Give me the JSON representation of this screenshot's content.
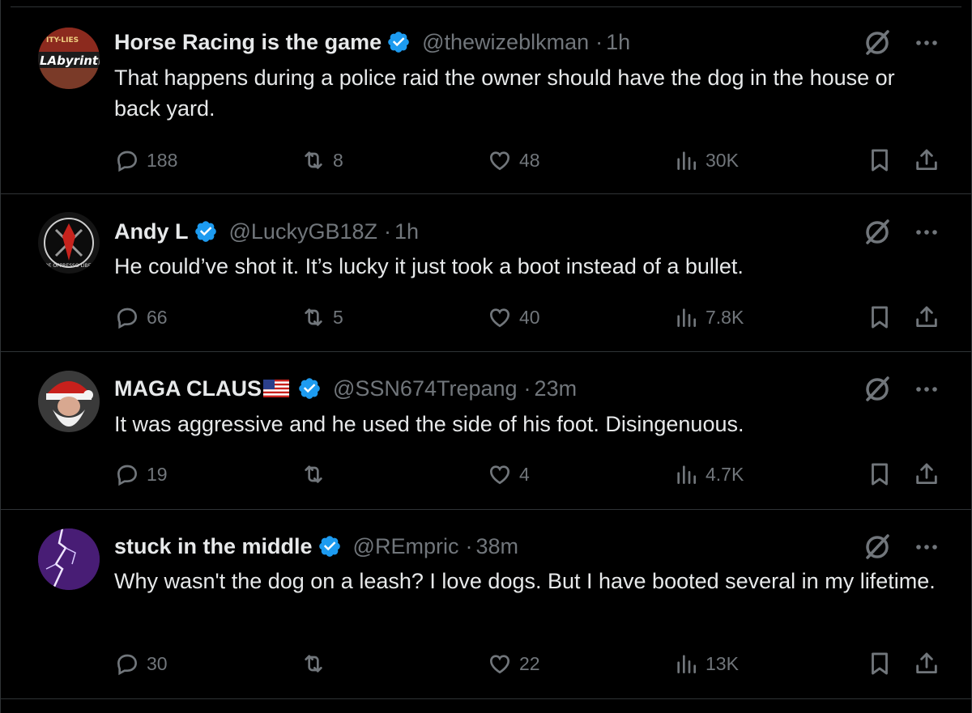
{
  "colors": {
    "background": "#000000",
    "text": "#e7e9ea",
    "muted": "#71767b",
    "divider": "#2f3336",
    "verified": "#1d9bf0"
  },
  "tweets": [
    {
      "name": "Horse Racing is the game",
      "handle": "@thewizeblkman",
      "sep": "·",
      "time": "1h",
      "text": "That happens during a police raid the owner should have the dog in the house or back yard.",
      "avatar_text": "LAbyrinth",
      "avatar_top_text": "ITY-LIES",
      "replies": "188",
      "retweets": "8",
      "likes": "48",
      "views": "30K"
    },
    {
      "name": "Andy L",
      "handle": "@LuckyGB18Z",
      "sep": "·",
      "time": "1h",
      "text": "He could’ve shot it. It’s lucky it just took a boot instead of a bullet.",
      "avatar_text": "DE OPPRESSO LIBER",
      "replies": "66",
      "retweets": "5",
      "likes": "40",
      "views": "7.8K"
    },
    {
      "name": "MAGA CLAUS",
      "handle": "@SSN674Trepang",
      "sep": "·",
      "time": "23m",
      "text": "It was aggressive and he used the side of his foot. Disingenuous.",
      "replies": "19",
      "retweets": "",
      "likes": "4",
      "views": "4.7K"
    },
    {
      "name": "stuck in the middle",
      "handle": "@REmpric",
      "sep": "·",
      "time": "38m",
      "text": "Why wasn't the dog on a leash? I love dogs. But I have booted several in my lifetime.",
      "replies": "30",
      "retweets": "",
      "likes": "22",
      "views": "13K"
    }
  ],
  "icons": {
    "reply": "speech-bubble-icon",
    "retweet": "retweet-arrows-icon",
    "like": "heart-icon",
    "views": "bar-chart-icon",
    "bookmark": "bookmark-icon",
    "share": "share-upload-icon",
    "grok": "grok-slash-circle-icon",
    "more": "ellipsis-icon",
    "verified": "verified-badge-icon",
    "flag": "us-flag-icon"
  }
}
